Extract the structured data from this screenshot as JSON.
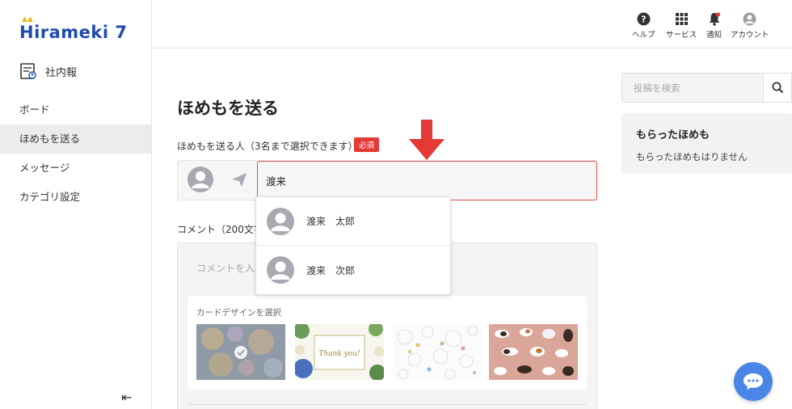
{
  "brand": {
    "logo_text": "Hirameki 7"
  },
  "sidebar": {
    "section_label": "社内報",
    "items": [
      {
        "label": "ボード",
        "active": false
      },
      {
        "label": "ほめもを送る",
        "active": true
      },
      {
        "label": "メッセージ",
        "active": false
      },
      {
        "label": "カテゴリ設定",
        "active": false
      }
    ]
  },
  "header": {
    "help": "ヘルプ",
    "services": "サービス",
    "notifications": "通知",
    "account": "アカウント"
  },
  "main": {
    "title": "ほめもを送る",
    "sender_label": "ほめもを送る人（3名まで選択できます）",
    "required_badge": "必須",
    "name_input_value": "渡来",
    "suggestions": [
      "渡来　太郎",
      "渡来　次郎"
    ],
    "comment_label": "コメント（200文字",
    "comment_placeholder": "コメントを入力",
    "card_design_label": "カードデザインを選択",
    "cards": [
      {
        "name": "bubbles",
        "selected": true
      },
      {
        "name": "thank-you-flowers",
        "selected": false,
        "text": "Thank you!"
      },
      {
        "name": "dandelions",
        "selected": false
      },
      {
        "name": "cats",
        "selected": false
      }
    ]
  },
  "right": {
    "search_placeholder": "投稿を検索",
    "received_title": "もらったほめも",
    "received_empty": "もらったほめもはりません"
  },
  "colors": {
    "brand": "#1e4bb0",
    "accent_red": "#e53935",
    "chat_blue": "#4a86e8"
  }
}
